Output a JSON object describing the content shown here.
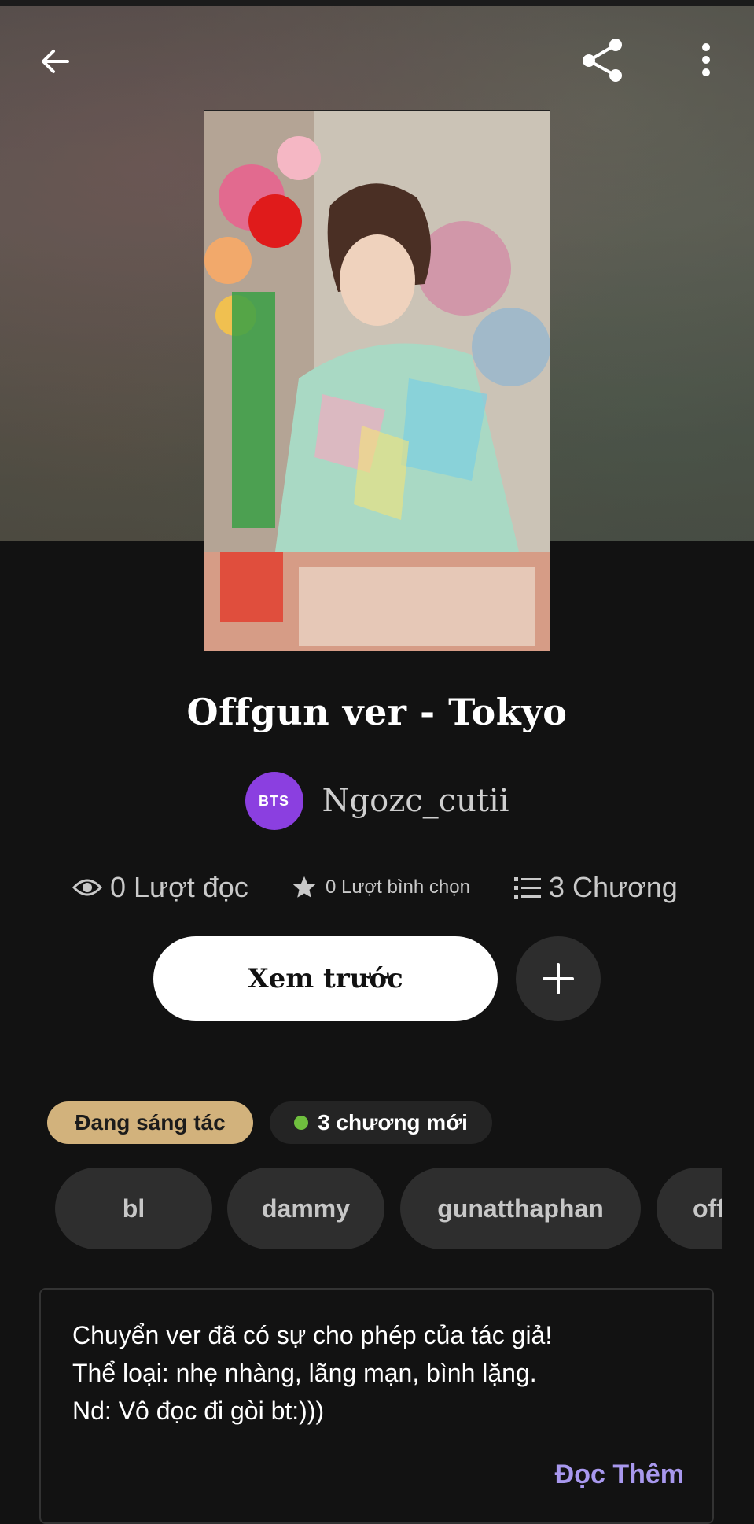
{
  "story": {
    "title": "Offgun ver - Tokyo",
    "author": "Ngozc_cutii",
    "avatar_text": "BTS"
  },
  "stats": {
    "reads": "0 Lượt đọc",
    "votes": "0 Lượt bình chọn",
    "chapters": "3 Chương"
  },
  "actions": {
    "preview_label": "Xem trước"
  },
  "badges": {
    "status": "Đang sáng tác",
    "new_chapters": "3 chương mới"
  },
  "tags": [
    "bl",
    "dammy",
    "gunatthaphan",
    "off"
  ],
  "description": {
    "lines": [
      "Chuyển ver đã có sự cho phép của tác giả!",
      "Thể loại: nhẹ nhàng, lãng mạn, bình lặng.",
      "Nd: Vô đọc đi gòi bt:)))"
    ],
    "read_more": "Đọc Thêm"
  },
  "colors": {
    "background": "#121212",
    "status_badge": "#d2b27c",
    "new_dot": "#6fbf3e",
    "avatar": "#8b3fe0",
    "read_more": "#a898ee"
  },
  "icons": {
    "back": "arrow-left-icon",
    "share": "share-icon",
    "more": "more-vertical-icon",
    "reads": "eye-icon",
    "votes": "star-icon",
    "chapters": "list-icon",
    "add": "plus-icon"
  }
}
